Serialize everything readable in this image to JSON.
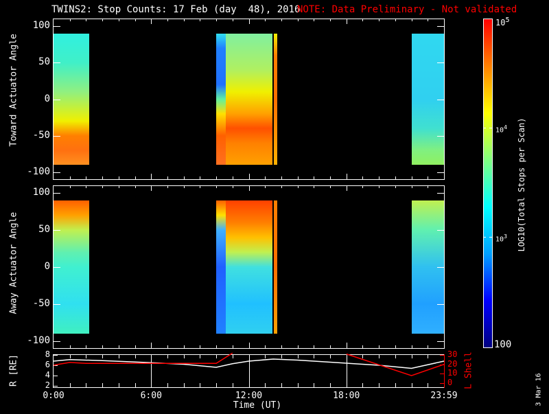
{
  "title": {
    "main": "TWINS2: Stop Counts: 17 Feb (day  48), 2016",
    "note": "NOTE: Data Preliminary - Not validated",
    "note_color": "#ff0000"
  },
  "footer_date": "3 Mar 16",
  "chart_data": [
    {
      "type": "heatmap",
      "name": "toward",
      "ylabel": "Toward Actuator Angle",
      "ylim": [
        -110,
        110
      ],
      "yticks": [
        "100",
        "50",
        "0",
        "-50",
        "-100"
      ],
      "ytick_values": [
        100,
        50,
        0,
        -50,
        -100
      ],
      "xlim_hours": [
        0,
        24
      ],
      "segments": [
        {
          "t0": 0.0,
          "t1": 2.2,
          "stops": [
            [
              90,
              "#30f0e0"
            ],
            [
              50,
              "#40f0c8"
            ],
            [
              10,
              "#90f080"
            ],
            [
              -30,
              "#f0f000"
            ],
            [
              -50,
              "#ff8000"
            ],
            [
              -70,
              "#ff7010"
            ],
            [
              -90,
              "#ff9020"
            ]
          ]
        },
        {
          "t0": 10.0,
          "t1": 10.6,
          "stops": [
            [
              90,
              "#30e0f0"
            ],
            [
              70,
              "#2080ff"
            ],
            [
              20,
              "#2070ff"
            ],
            [
              0,
              "#60f0a0"
            ],
            [
              -20,
              "#ffe000"
            ],
            [
              -50,
              "#ff6000"
            ],
            [
              -90,
              "#ff7020"
            ]
          ]
        },
        {
          "t0": 10.6,
          "t1": 13.45,
          "stops": [
            [
              90,
              "#80f0a0"
            ],
            [
              40,
              "#b0f060"
            ],
            [
              10,
              "#f0f000"
            ],
            [
              -20,
              "#ffa000"
            ],
            [
              -40,
              "#ff5000"
            ],
            [
              -60,
              "#ff8000"
            ],
            [
              -90,
              "#ffa000"
            ]
          ]
        },
        {
          "t0": 13.55,
          "t1": 13.75,
          "stops": [
            [
              90,
              "#f0f000"
            ],
            [
              60,
              "#ff8000"
            ],
            [
              0,
              "#ff7000"
            ],
            [
              -90,
              "#ffb000"
            ]
          ]
        },
        {
          "t0": 22.0,
          "t1": 24.0,
          "stops": [
            [
              90,
              "#30d8f0"
            ],
            [
              0,
              "#30d0f0"
            ],
            [
              -40,
              "#40e0d0"
            ],
            [
              -70,
              "#80f080"
            ],
            [
              -90,
              "#90f060"
            ]
          ]
        }
      ]
    },
    {
      "type": "heatmap",
      "name": "away",
      "ylabel": "Away Actuator Angle",
      "ylim": [
        -110,
        110
      ],
      "yticks": [
        "100",
        "50",
        "0",
        "-50",
        "-100"
      ],
      "ytick_values": [
        100,
        50,
        0,
        -50,
        -100
      ],
      "xlim_hours": [
        0,
        24
      ],
      "segments": [
        {
          "t0": 0.0,
          "t1": 2.2,
          "stops": [
            [
              90,
              "#ff6000"
            ],
            [
              70,
              "#ffa000"
            ],
            [
              50,
              "#c0f050"
            ],
            [
              20,
              "#60f0b0"
            ],
            [
              0,
              "#40f0d0"
            ],
            [
              -50,
              "#30e0f0"
            ],
            [
              -90,
              "#40f0c0"
            ]
          ]
        },
        {
          "t0": 10.0,
          "t1": 10.6,
          "stops": [
            [
              90,
              "#ff6000"
            ],
            [
              70,
              "#ffe000"
            ],
            [
              50,
              "#40b0ff"
            ],
            [
              0,
              "#2060ff"
            ],
            [
              -90,
              "#2080ff"
            ]
          ]
        },
        {
          "t0": 10.6,
          "t1": 13.45,
          "stops": [
            [
              90,
              "#ff4000"
            ],
            [
              60,
              "#ff8000"
            ],
            [
              40,
              "#ffc000"
            ],
            [
              20,
              "#c0f050"
            ],
            [
              0,
              "#40e0e0"
            ],
            [
              -50,
              "#20c0ff"
            ],
            [
              -90,
              "#30d0f0"
            ]
          ]
        },
        {
          "t0": 13.55,
          "t1": 13.75,
          "stops": [
            [
              90,
              "#ff8000"
            ],
            [
              0,
              "#ff7000"
            ],
            [
              -90,
              "#ffa000"
            ]
          ]
        },
        {
          "t0": 22.0,
          "t1": 24.0,
          "stops": [
            [
              90,
              "#c0f050"
            ],
            [
              50,
              "#60f0b0"
            ],
            [
              0,
              "#30c0f0"
            ],
            [
              -50,
              "#20a0ff"
            ],
            [
              -90,
              "#30b0ff"
            ]
          ]
        }
      ]
    },
    {
      "type": "line",
      "name": "orbit",
      "ylabel": "R [RE]",
      "ylabel_right": "L Shell",
      "ylim": [
        2,
        8
      ],
      "ylim_right": [
        0,
        30
      ],
      "yticks": [
        "8",
        "6",
        "4",
        "2"
      ],
      "ytick_values": [
        8,
        6,
        4,
        2
      ],
      "yticks_right": [
        "30",
        "20",
        "10",
        "0"
      ],
      "ytick_values_right": [
        30,
        20,
        10,
        0
      ],
      "xlabel": "Time (UT)",
      "xticks": [
        "0:00",
        "6:00",
        "12:00",
        "18:00",
        "23:59"
      ],
      "xtick_values": [
        0,
        6,
        12,
        18,
        24
      ],
      "series": [
        {
          "name": "R",
          "color": "#ffffff",
          "x": [
            0,
            1,
            3,
            6,
            8,
            10,
            11,
            12,
            13.5,
            15,
            18,
            20,
            22,
            24
          ],
          "y": [
            6.8,
            7.1,
            6.9,
            6.5,
            6.2,
            5.6,
            6.3,
            6.8,
            7.2,
            7.0,
            6.4,
            6.0,
            5.4,
            6.8
          ]
        },
        {
          "name": "L Shell",
          "color": "#ff0000",
          "x": [
            0,
            0.3,
            1,
            2,
            10,
            11
          ],
          "y": [
            19,
            20,
            22,
            21,
            21,
            32
          ],
          "axis": "right"
        },
        {
          "name": "L Shell (late)",
          "color": "#ff0000",
          "x": [
            18,
            22,
            24
          ],
          "y": [
            31,
            8,
            20
          ],
          "axis": "right"
        }
      ]
    }
  ],
  "colorbar": {
    "label": "LOG10(Total Stops per Scan)",
    "ticks": [
      {
        "label": "10^5",
        "base": "10",
        "exp": "5",
        "value": 100000
      },
      {
        "label": "10^4",
        "base": "10",
        "exp": "4",
        "value": 10000
      },
      {
        "label": "10^3",
        "base": "10",
        "exp": "3",
        "value": 1000
      }
    ],
    "bottom_label": "100",
    "range": [
      100,
      100000
    ],
    "colors": [
      "#000080",
      "#0000ff",
      "#00a0ff",
      "#00ffff",
      "#80ff80",
      "#ffff00",
      "#ff8000",
      "#ff0000"
    ]
  }
}
